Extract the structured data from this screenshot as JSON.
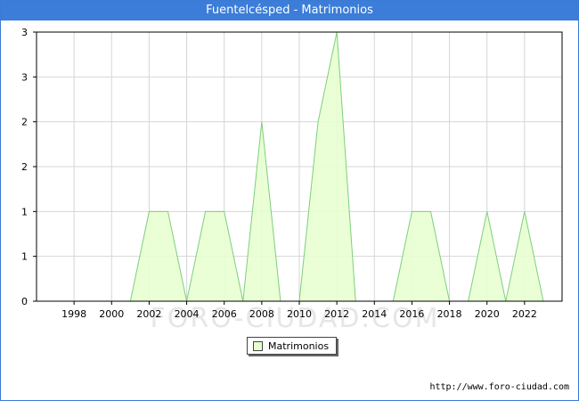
{
  "title": "Fuentelcésped - Matrimonios",
  "watermark": "FORO-CIUDAD.COM",
  "credit": "http://www.foro-ciudad.com",
  "legend_label": "Matrimonios",
  "colors": {
    "title_bg": "#3b7dd8",
    "fill": "#e8ffd0",
    "stroke": "#7ccf7c",
    "grid": "#d6d6d6"
  },
  "chart_data": {
    "type": "area",
    "title": "Fuentelcésped - Matrimonios",
    "series": [
      {
        "name": "Matrimonios",
        "x": [
          1997,
          1998,
          1999,
          2000,
          2001,
          2002,
          2003,
          2004,
          2005,
          2006,
          2007,
          2008,
          2009,
          2010,
          2011,
          2012,
          2013,
          2014,
          2015,
          2016,
          2017,
          2018,
          2019,
          2020,
          2021,
          2022,
          2023
        ],
        "values": [
          0,
          0,
          0,
          0,
          0,
          1,
          1,
          0,
          1,
          1,
          0,
          2,
          0,
          0,
          2,
          3,
          0,
          0,
          0,
          1,
          1,
          0,
          0,
          1,
          0,
          1,
          0
        ]
      }
    ],
    "x_ticks": [
      1998,
      2000,
      2002,
      2004,
      2006,
      2008,
      2010,
      2012,
      2014,
      2016,
      2018,
      2020,
      2022
    ],
    "y_ticks": [
      0,
      1,
      2,
      3
    ],
    "y_tick_labels": [
      "0",
      "1",
      "1",
      "2",
      "2",
      "3",
      "3"
    ],
    "xlim": [
      1996,
      2024
    ],
    "ylim": [
      0,
      3
    ],
    "grid": true,
    "legend_position": "bottom"
  }
}
